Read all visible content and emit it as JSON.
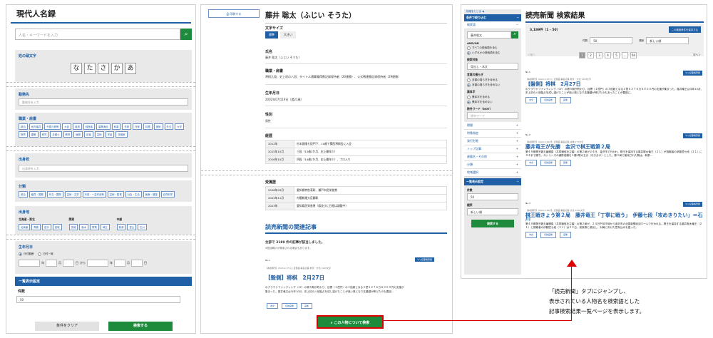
{
  "left": {
    "title": "現代人名録",
    "search_placeholder": "人名・キーワードを入力",
    "initial_label": "姓の頭文字",
    "kana": [
      "な",
      "た",
      "さ",
      "か",
      "あ"
    ],
    "work_label": "勤務先",
    "work_placeholder": "勤務先を入力",
    "job_label": "職業・肩書",
    "job_tags": [
      "政治",
      "地方議員",
      "外国元首等",
      "大臣",
      "経済",
      "経営者",
      "農業漁民",
      "和薬",
      "作家",
      "作家",
      "料理",
      "美術",
      "外交",
      "大学",
      "財界",
      "建築",
      "研究",
      "弁護士",
      "教育",
      "医師",
      "記者",
      "芸術",
      "学者",
      "評論家"
    ],
    "school_label": "出身校",
    "school_placeholder": "出身校を入力",
    "cat_label": "分類",
    "cat_tags": [
      "政治",
      "議員・国務",
      "外交・国際",
      "芸術・文学",
      "写真・一芸作品等",
      "芸術・監督",
      "社会・生活",
      "医療・健康",
      "自然科学"
    ],
    "region_label": "出身地",
    "region_groups": [
      {
        "name": "北海道・東北",
        "tags": [
          "北海道",
          "青森",
          "岩手",
          "宮城"
        ]
      },
      {
        "name": "関東",
        "tags": [
          "茨城",
          "栃木",
          "群馬",
          "埼玉"
        ]
      },
      {
        "name": "中部",
        "tags": [
          "新潟",
          "富山",
          "石川"
        ]
      }
    ],
    "birth_label": "生年月日",
    "birth_opt1": "日付範囲",
    "birth_opt2": "日付一致",
    "y": "年",
    "m": "月",
    "d": "日",
    "from": "から",
    "display_label": "一覧表示設定",
    "count_label": "件数",
    "count_value": "50",
    "clear_label": "条件をクリア",
    "search_label": "検索する"
  },
  "middle": {
    "print_label": "印刷する",
    "name": "藤井 聡太（ふじい そうた）",
    "charsize_label": "文字サイズ",
    "charsize_std": "標準",
    "charsize_big": "大きい",
    "name_label": "氏名",
    "name_value": "藤井 聡太（ふじい そうた）",
    "job_label": "職業・肩書",
    "job_value": "将棋九段、史上初の八冠、タイトル通算獲得数記録保持者（20連勝）、公式戦連勝記録保持者（29連勝）",
    "birth_label": "生年月日",
    "birth_value": "2002年07月19日（満21歳）",
    "gender_label": "性別",
    "gender_value": "男性",
    "career_label": "経歴",
    "career": [
      [
        "2012年",
        "杉本昌隆七段門下、10歳で関西将棋会に入会"
      ],
      [
        "2015年10月",
        "三段（13歳2か月、史上最年少）"
      ],
      [
        "2016年10月",
        "四段（14歳2か月、史上最年少）、プロ入り"
      ]
    ],
    "award_label": "受賞歴",
    "awards": [
      [
        "2018年03月",
        "愛知県特別表彰、瀬戸市民栄誉賞"
      ],
      [
        "2022年11月",
        "内閣総理大臣顕彰"
      ],
      [
        "2023年",
        "愛知県民栄誉賞（県並びに日程は調整中）"
      ]
    ],
    "related_title": "読売新聞の関連記事",
    "count_text": "全部で 3189 件の記事が該当しました。",
    "note": "※指定職人が検索される場合もあります。",
    "mylist": "マイ記事帳登録",
    "art_no": "No.1",
    "art_meta": "【本紙朝刊】2024.2.27(火)  直撃面  署名記事  教育・文化  1200文字",
    "art_title": "【盤側】将棋　2月27日",
    "art_text1": "のクラウドファンディング（CF）の第５期が終わり、目標（１億円）の３倍超となる３億５２７６万６０００円の支援が",
    "art_text2": "集まった。藤井竜王は今年10月、史上初の八冠独占を成し遂げたことが追い風となり支援額が伸びたのも要因...",
    "btn1": "本文",
    "btn2": "切抜画像",
    "btn3": "画像",
    "about_btn": "この人物について検索"
  },
  "right": {
    "side_toggle": "詳細をとじる ◀",
    "cond_label": "条件で絞り込む",
    "kw_label": "検索語",
    "kw_value": "藤井聡太",
    "andor_label": "AND/OR",
    "andor1": "すべての検索語を含む",
    "andor2": "いずれかの検索語を含む",
    "target_label": "検索対象",
    "target_value": "見出し・本文",
    "ruby_label": "言葉の揺らぎ",
    "ruby1": "言葉の揺らぎを含める",
    "ruby2": "言葉の揺らぎを含めない",
    "kanji_label": "異体字",
    "kanji1": "異体字を含める",
    "kanji2": "異体字を含めない",
    "exclude_label": "除外ワード（NOT）",
    "exclude_placeholder": "除外ワード",
    "filters": [
      "期間",
      "特殊指定",
      "発行形態",
      "トップ記事",
      "連載名・その他",
      "分類",
      "地域選択"
    ],
    "display_label": "一覧表示設定",
    "count_label": "件数",
    "count_value": "50",
    "order_label": "順序",
    "order_value": "新しい順",
    "search_label": "検索する",
    "title": "読売新聞 検索結果",
    "total": "3,189件（1 - 50）",
    "save_cond": "この検索条件を保存する",
    "list_count_label": "件数",
    "list_count_value": "50",
    "list_order_label": "順序",
    "list_order_value": "新しい順",
    "prev": "前へ",
    "next": "次へ",
    "pages": [
      "1",
      "2",
      "3",
      "4",
      "5",
      "…",
      "64"
    ],
    "mylist": "マイ記事帳登録",
    "articles": [
      {
        "no": "No.1",
        "meta": "【本紙朝刊】2024.2.27(火)  直撃面  署名記事  教育・文化  1200文字",
        "title": "【盤側】将棋　2月27日",
        "text": "のクラウドファンディング（CF）の第５期が終わり、目標（１億円）の３倍超となる３億５２７６万６０００円の支援が集まった。藤井竜王は今年10月、史上初の八冠独占を成し遂げたことが追い風となり支援額が伸びたのもあったことが要因に。"
      },
      {
        "no": "No.2",
        "meta": "【本紙朝刊】2024.2.26(月)  直撃面  署名記事  将棋  277文字",
        "title": "藤井竜王が先勝　金沢で棋王戦第２局",
        "text": "第４９期棋王戦五番勝負（共同通信社主催）の第２局が２４日、金沢市で行われ、棋王を保持する藤井聡太竜王（２１）が挑戦者の伊藤匠七段（２１）に９４手で勝ち、今シリーズの通算成績を１勝1敗の五分（引き分け）とした。第３局で使用された駒は、和泉..."
      },
      {
        "no": "No.3",
        "meta": "【本紙朝刊】2024.2.26(月)  直撃面  署名記事  文化  2016文字",
        "title": "棋王戦きょう第２局　藤井竜王「丁寧に戦う」　伊藤七段「攻めきりたい」＝石川",
        "text": "第４９期棋王戦五番勝負（共同通信社主催）の第２局が、２４日午前９時から金沢市の北国新聞赤羽ホールで行われる。棋王を保持する藤井聡太竜王（２１）と挑戦者の伊藤匠七段（２１）は２３日、前夜祭に参加し、対局に向けた意気込みを語った。"
      }
    ],
    "btn1": "本文",
    "btn2": "切抜画像",
    "btn3": "画像"
  },
  "callout": {
    "line1": "「読売新聞」タブにジャンプし、",
    "line2": "表示されている人物名を検索語とした",
    "line3": "記事検索結果一覧ページを表示します。"
  },
  "colors": {
    "accent": "#1f5fa6",
    "green": "#1d8a3c",
    "arrow": "#dd0000",
    "highlight": "#d7f0c0"
  }
}
